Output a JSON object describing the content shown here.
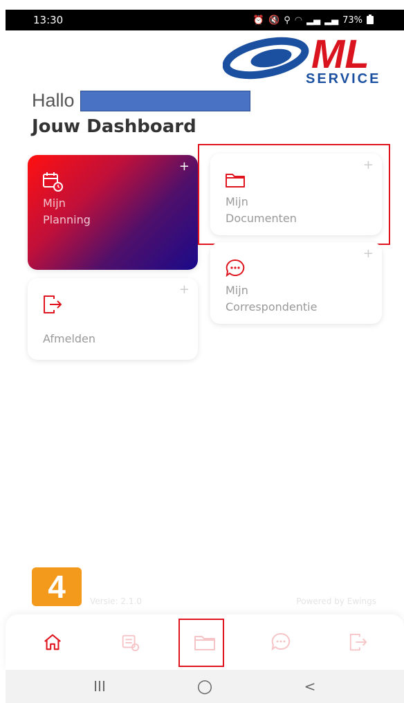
{
  "status_bar": {
    "time": "13:30",
    "battery": "73%",
    "icons": [
      "alarm-icon",
      "mute-icon",
      "location-icon",
      "wifi-icon",
      "signal-icon",
      "signal-icon",
      "battery-icon"
    ]
  },
  "logo": {
    "brand": "ML",
    "sub": "SERVICE"
  },
  "greeting": {
    "hello": "Hallo",
    "name_redacted": true
  },
  "dashboard_title": "Jouw Dashboard",
  "tiles": [
    {
      "id": "planning",
      "label_line1": "Mijn",
      "label_line2": "Planning",
      "icon": "calendar-icon",
      "active": true
    },
    {
      "id": "documenten",
      "label_line1": "Mijn",
      "label_line2": "Documenten",
      "icon": "folder-icon",
      "highlighted": true
    },
    {
      "id": "correspondentie",
      "label_line1": "Mijn",
      "label_line2": "Correspondentie",
      "icon": "chat-icon"
    },
    {
      "id": "afmelden",
      "label_line1": "Afmelden",
      "icon": "logout-icon"
    }
  ],
  "plus_symbol": "+",
  "footer": {
    "badge": "4",
    "version": "Versie: 2.1.0",
    "powered": "Powered by Ewings"
  },
  "bottom_nav": [
    "home-icon",
    "planning-icon",
    "folder-icon",
    "chat-icon",
    "logout-icon"
  ],
  "android_nav": {
    "recents": "III",
    "home": "○",
    "back": "<"
  },
  "colors": {
    "accent": "#e0141e",
    "badge": "#f39a1c",
    "logo_blue": "#1b4fa0",
    "logo_red": "#d9141e"
  }
}
